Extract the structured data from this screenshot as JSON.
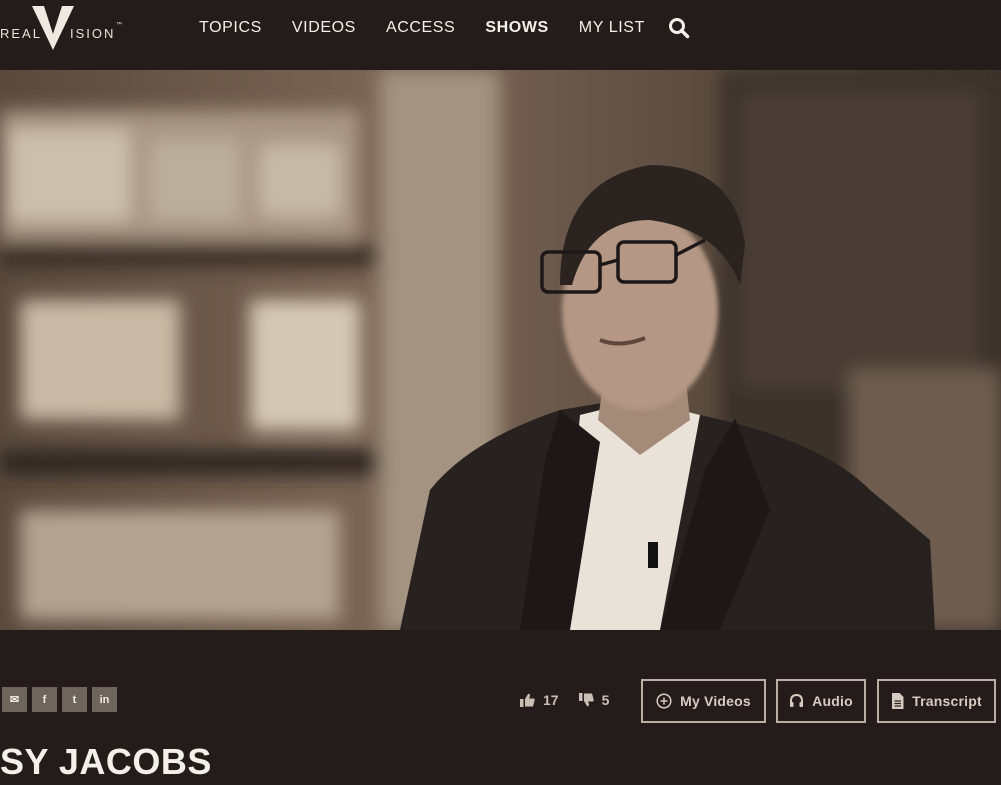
{
  "brand": {
    "left": "REAL",
    "right": "ISION",
    "mark": "™"
  },
  "nav": {
    "items": [
      {
        "label": "TOPICS"
      },
      {
        "label": "VIDEOS"
      },
      {
        "label": "ACCESS"
      },
      {
        "label": "SHOWS"
      },
      {
        "label": "MY LIST"
      }
    ],
    "active": "SHOWS"
  },
  "share": [
    {
      "icon": "email-icon",
      "glyph": "✉"
    },
    {
      "icon": "facebook-icon",
      "glyph": "f"
    },
    {
      "icon": "twitter-icon",
      "glyph": "t"
    },
    {
      "icon": "linkedin-icon",
      "glyph": "in"
    }
  ],
  "votes": {
    "likes": "17",
    "dislikes": "5"
  },
  "actions": {
    "my_videos": "My Videos",
    "audio": "Audio",
    "transcript": "Transcript"
  },
  "video": {
    "title": "SY JACOBS"
  },
  "colors": {
    "background": "#231c1a",
    "text": "#f2ede6",
    "button_border": "#b9b0a4",
    "share_bg": "#6e655c"
  }
}
